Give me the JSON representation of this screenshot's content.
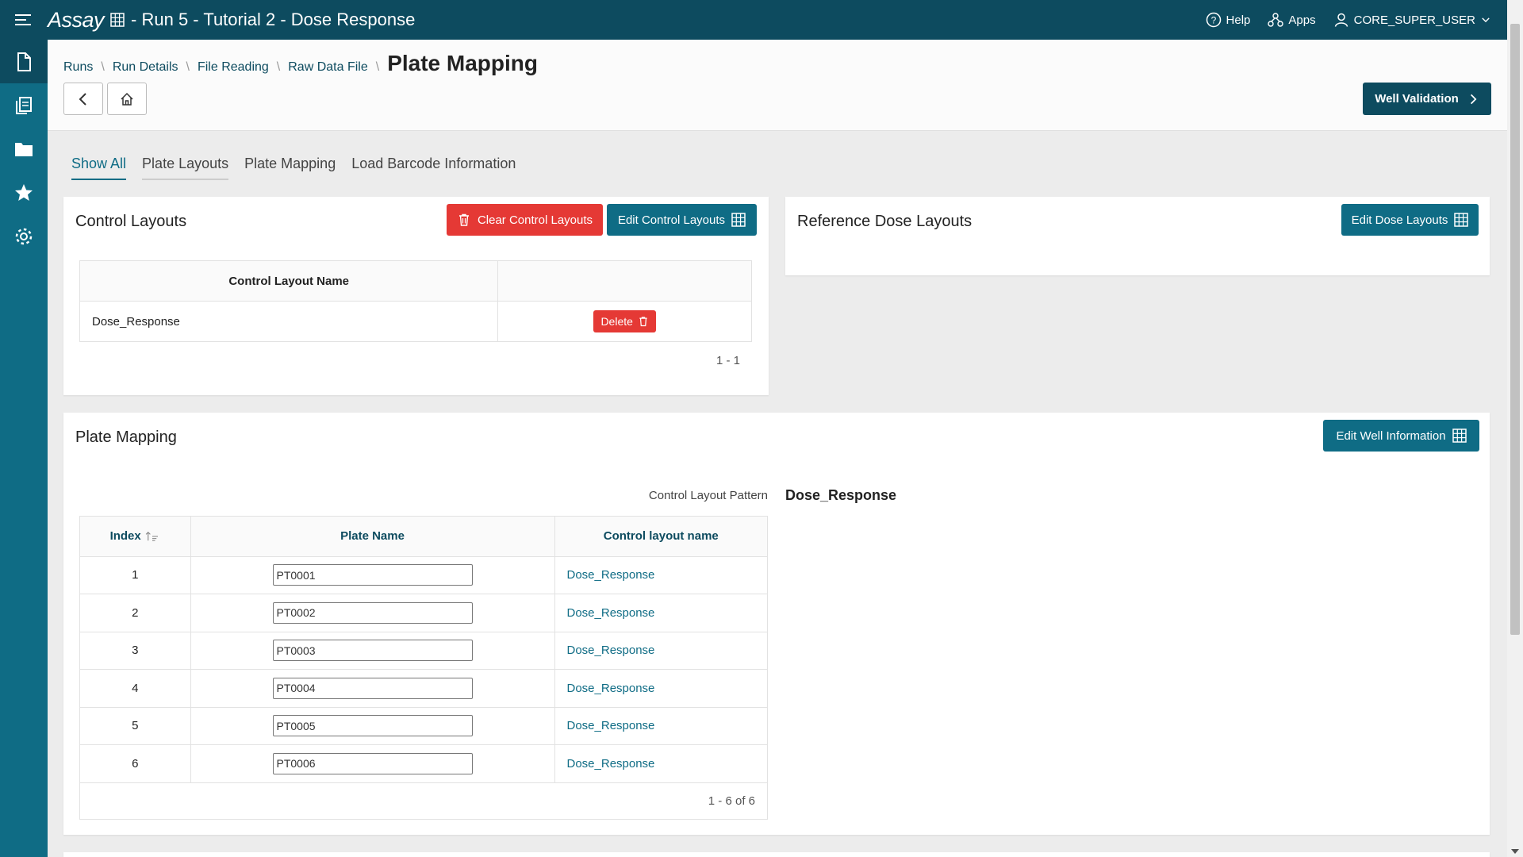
{
  "topbar": {
    "brand": "Assay",
    "title": "- Run 5 - Tutorial 2 - Dose Response",
    "help": "Help",
    "apps": "Apps",
    "user": "CORE_SUPER_USER"
  },
  "breadcrumb": {
    "items": [
      "Runs",
      "Run Details",
      "File Reading",
      "Raw Data File"
    ],
    "current": "Plate Mapping"
  },
  "header": {
    "well_validation": "Well Validation"
  },
  "tabs": [
    "Show All",
    "Plate Layouts",
    "Plate Mapping",
    "Load Barcode Information"
  ],
  "control_layouts": {
    "title": "Control Layouts",
    "clear_btn": "Clear Control Layouts",
    "edit_btn": "Edit Control Layouts",
    "column": "Control Layout Name",
    "rows": [
      {
        "name": "Dose_Response",
        "delete": "Delete"
      }
    ],
    "pager": "1 - 1"
  },
  "reference": {
    "title": "Reference Dose Layouts",
    "edit_btn": "Edit Dose Layouts"
  },
  "plate_mapping": {
    "title": "Plate Mapping",
    "edit_btn": "Edit Well Information",
    "pattern_label": "Control Layout Pattern",
    "pattern_value": "Dose_Response",
    "columns": [
      "Index",
      "Plate Name",
      "Control layout name"
    ],
    "rows": [
      {
        "index": "1",
        "plate": "PT0001",
        "layout": "Dose_Response"
      },
      {
        "index": "2",
        "plate": "PT0002",
        "layout": "Dose_Response"
      },
      {
        "index": "3",
        "plate": "PT0003",
        "layout": "Dose_Response"
      },
      {
        "index": "4",
        "plate": "PT0004",
        "layout": "Dose_Response"
      },
      {
        "index": "5",
        "plate": "PT0005",
        "layout": "Dose_Response"
      },
      {
        "index": "6",
        "plate": "PT0006",
        "layout": "Dose_Response"
      }
    ],
    "pager": "1 - 6 of 6"
  },
  "colors": {
    "primary": "#0d4b5f",
    "accent": "#0f6c85",
    "danger": "#e53935"
  }
}
